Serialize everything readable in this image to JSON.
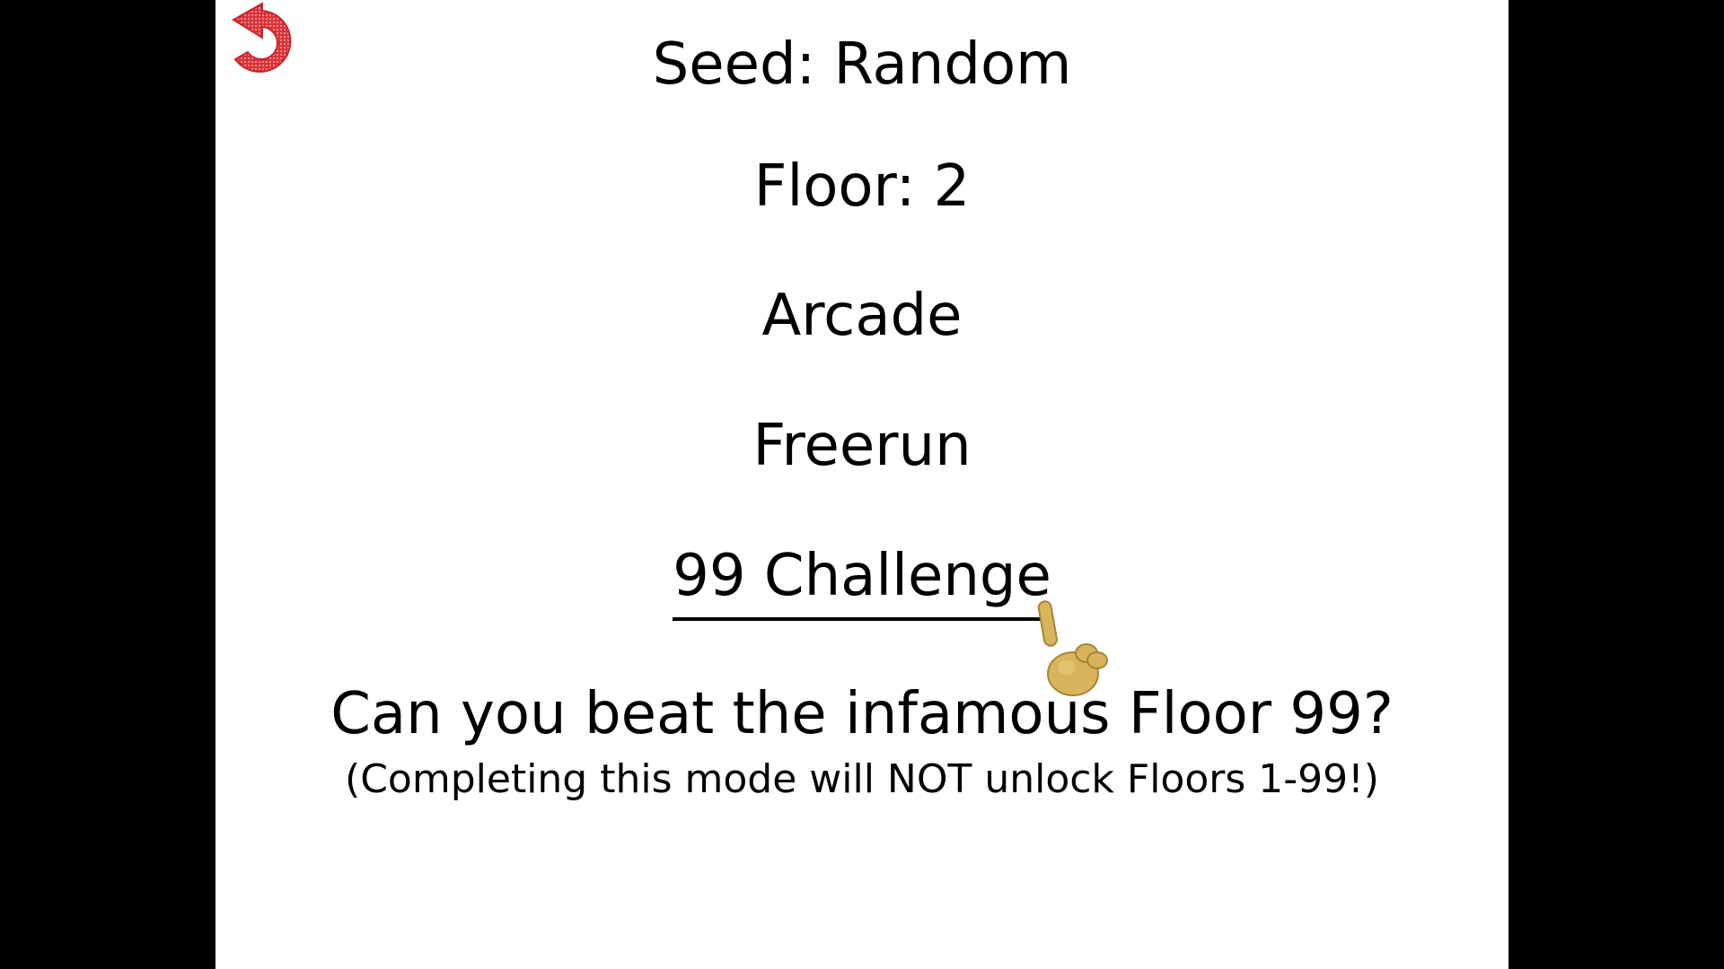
{
  "menu": {
    "seed_label": "Seed: Random",
    "floor_label": "Floor: 2",
    "arcade_label": "Arcade",
    "freerun_label": "Freerun",
    "challenge_label": "99 Challenge"
  },
  "description": {
    "title": "Can you beat the infamous Floor 99?",
    "note": "(Completing this mode will NOT unlock Floors 1-99!)"
  },
  "icons": {
    "back": "back-arrow-icon",
    "cursor": "hand-pointer-icon"
  },
  "colors": {
    "background": "#ffffff",
    "letterbox": "#000000",
    "text": "#000000",
    "back_icon": "#d9333a",
    "cursor_hand": "#d8b45a"
  }
}
